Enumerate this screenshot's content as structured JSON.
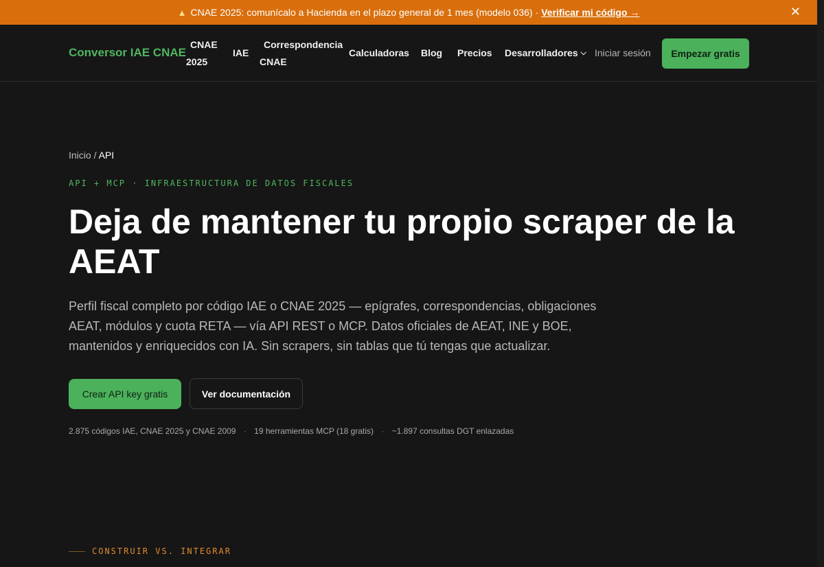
{
  "banner": {
    "icon": "warning-icon",
    "text": "CNAE 2025: comunícalo a Hacienda en el plazo general de 1 mes (modelo 036)",
    "separator": "·",
    "link": "Verificar mi código →",
    "close": "✕",
    "color": "#d96f0c"
  },
  "nav": {
    "logo": "Conversor IAE CNAE",
    "items": [
      {
        "line1": "CNAE",
        "line2": "2025"
      },
      {
        "label": "IAE"
      },
      {
        "line1": "Correspondencia",
        "line2": "CNAE"
      },
      {
        "label": "Calculadoras"
      },
      {
        "label": "Blog"
      },
      {
        "label": "Precios"
      },
      {
        "label": "Desarrolladores",
        "icon": "chevron-down-icon"
      }
    ],
    "login": "Iniciar sesión",
    "cta": "Empezar gratis"
  },
  "breadcrumb": {
    "home": "Inicio",
    "separator": "/",
    "current": "API"
  },
  "hero": {
    "eyebrow": "API + MCP · INFRAESTRUCTURA DE DATOS FISCALES",
    "title": "Deja de mantener tu propio scraper de la AEAT",
    "description": "Perfil fiscal completo por código IAE o CNAE 2025 — epígrafes, correspondencias, obligaciones AEAT, módulos y cuota RETA — vía API REST o MCP. Datos oficiales de AEAT, INE y BOE, mantenidos y enriquecidos con IA. Sin scrapers, sin tablas que tú tengas que actualizar.",
    "primary_button": "Crear API key gratis",
    "secondary_button": "Ver documentación",
    "stats": [
      "2.875 códigos IAE, CNAE 2025 y CNAE 2009",
      "19 herramientas MCP (18 gratis)",
      "~1.897 consultas DGT enlazadas"
    ],
    "stats_separator": "·"
  },
  "next_section": {
    "label": "CONSTRUIR VS. INTEGRAR"
  },
  "colors": {
    "accent": "#4bb15b",
    "background": "#161616",
    "warning": "#e08a2c"
  }
}
